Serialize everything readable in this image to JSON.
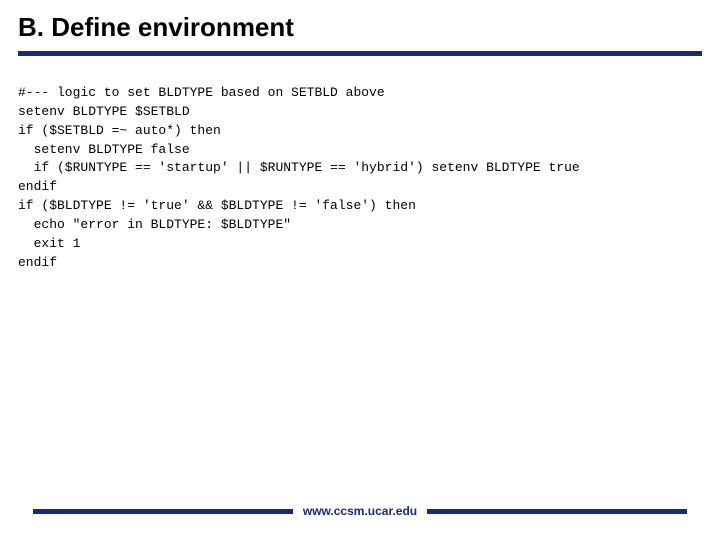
{
  "title": "B. Define environment",
  "code_lines": [
    "#--- logic to set BLDTYPE based on SETBLD above",
    "setenv BLDTYPE $SETBLD",
    "if ($SETBLD =~ auto*) then",
    "  setenv BLDTYPE false",
    "  if ($RUNTYPE == 'startup' || $RUNTYPE == 'hybrid') setenv BLDTYPE true",
    "endif",
    "if ($BLDTYPE != 'true' && $BLDTYPE != 'false') then",
    "  echo \"error in BLDTYPE: $BLDTYPE\"",
    "  exit 1",
    "endif"
  ],
  "footer": "www.ccsm.ucar.edu"
}
